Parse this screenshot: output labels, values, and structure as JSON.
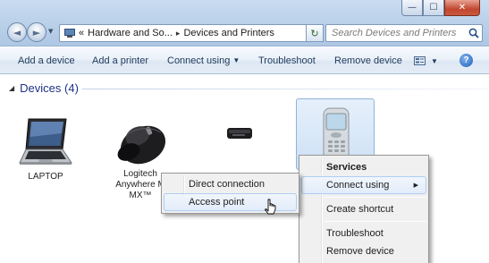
{
  "window": {
    "controls": {
      "minimize": "—",
      "maximize": "☐",
      "close": "✕"
    }
  },
  "nav": {
    "back": "◄",
    "forward": "►",
    "recent": "▼"
  },
  "address": {
    "overflow": "«",
    "crumbs": [
      "Hardware and So...",
      "Devices and Printers"
    ],
    "separator": "▸",
    "dropdown": "▼",
    "refresh": "↻"
  },
  "search": {
    "placeholder": "Search Devices and Printers",
    "icon": "search-icon"
  },
  "toolbar": {
    "add_device": "Add a device",
    "add_printer": "Add a printer",
    "connect_using": "Connect using",
    "troubleshoot": "Troubleshoot",
    "remove_device": "Remove device",
    "dropdown_arrow": "▼",
    "help": "?"
  },
  "group": {
    "title": "Devices (4)",
    "collapse": "◢"
  },
  "devices": [
    {
      "name": "LAPTOP",
      "icon": "laptop-icon"
    },
    {
      "name_line1": "Logitech",
      "name_line2": "Anywhere M",
      "name_line3": "MX™",
      "icon": "mouse-icon"
    },
    {
      "name": "",
      "icon": "usb-receiver-icon"
    },
    {
      "name": "",
      "icon": "phone-icon",
      "selected": true
    }
  ],
  "context_menu": {
    "items": [
      "Services",
      "Connect using",
      "Create shortcut",
      "Troubleshoot",
      "Remove device"
    ],
    "submenu_arrow": "▶"
  },
  "submenu": {
    "items": [
      "Direct connection",
      "Access point"
    ],
    "hovered": "Access point"
  },
  "colors": {
    "accent_blue": "#1e3287",
    "toolbar_text": "#1e395b",
    "menu_bg": "#f0f0f0",
    "highlight": "#aecdf3"
  }
}
